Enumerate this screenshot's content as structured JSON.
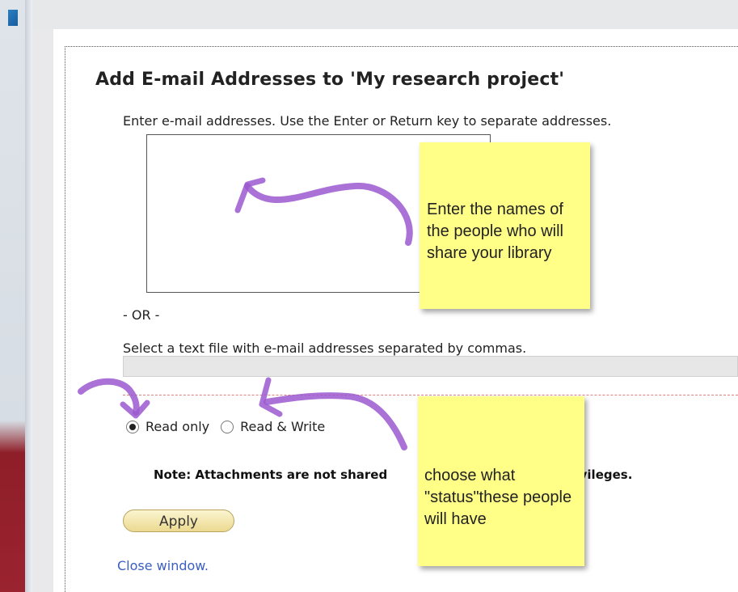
{
  "dialog": {
    "title": "Add E-mail Addresses to 'My research project'",
    "instruction": "Enter e-mail addresses. Use the Enter or Return key to separate addresses.",
    "email_value": "",
    "or_label": "- OR -",
    "file_label": "Select a text file with e-mail addresses separated by commas.",
    "radio_options": [
      {
        "label": "Read only",
        "checked": true
      },
      {
        "label": "Read & Write",
        "checked": false
      }
    ],
    "note": "Note: Attachments are not shared",
    "note_tail": "s privileges.",
    "apply_label": "Apply",
    "close_label": "Close window."
  },
  "annotations": {
    "sticky_note_1": "Enter the names of the people who will share your library",
    "sticky_note_2": "choose what \"status\"these people will have"
  },
  "colors": {
    "sticky": "#ffff88",
    "arrow": "#9b59d0",
    "link": "#3a5fc0",
    "button": "#ecd990"
  }
}
